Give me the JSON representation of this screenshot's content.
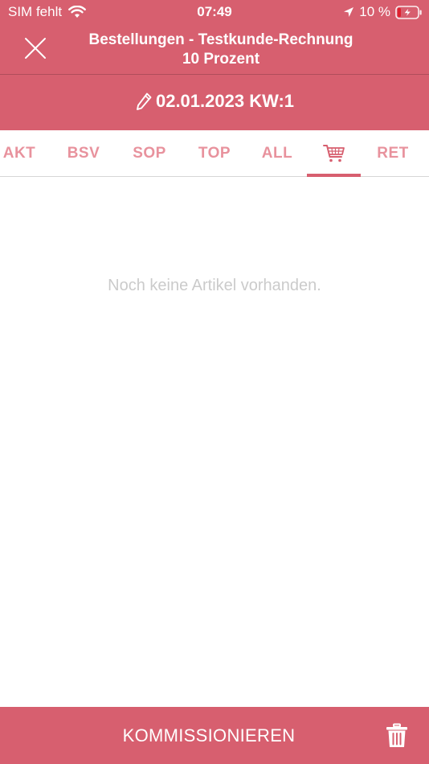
{
  "status_bar": {
    "carrier": "SIM fehlt",
    "time": "07:49",
    "battery": "10 %"
  },
  "header": {
    "title_line1": "Bestellungen - Testkunde-Rechnung",
    "title_line2": "10 Prozent",
    "date": "02.01.2023 KW:1"
  },
  "tabs": [
    {
      "label": "AKT"
    },
    {
      "label": "BSV"
    },
    {
      "label": "SOP"
    },
    {
      "label": "TOP"
    },
    {
      "label": "ALL"
    },
    {
      "label": "",
      "icon": "cart-icon",
      "active": true
    },
    {
      "label": "RET"
    }
  ],
  "main": {
    "empty_message": "Noch keine Artikel vorhanden."
  },
  "footer": {
    "primary_action": "KOMMISSIONIEREN"
  },
  "colors": {
    "primary": "#d75f6f",
    "tab_text": "#e8929d",
    "empty_text": "#cbcbcb"
  }
}
